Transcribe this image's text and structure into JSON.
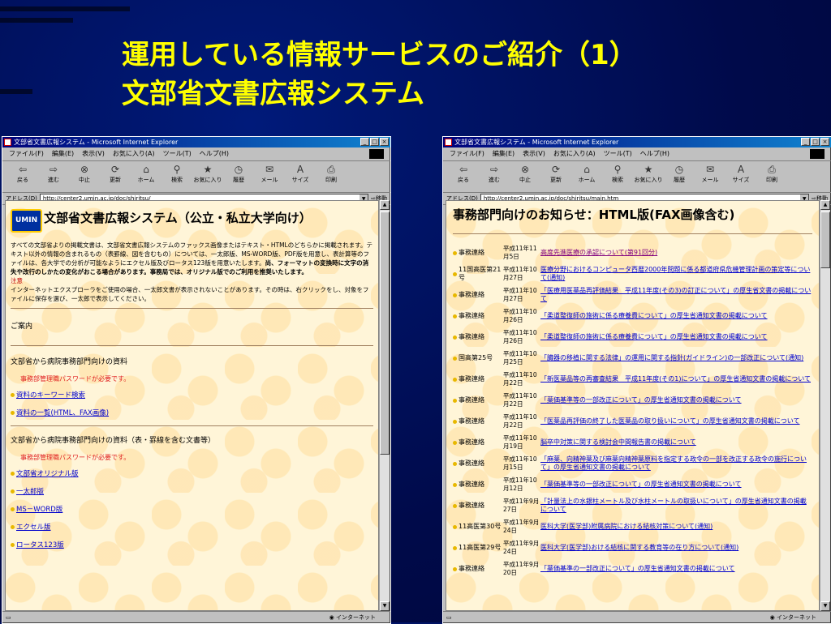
{
  "slide": {
    "title_line1": "運用している情報サービスのご紹介（1）",
    "title_line2": "文部省文書広報システム"
  },
  "left_window": {
    "title": "文部省文書広報システム - Microsoft Internet Explorer",
    "menu": [
      "ファイル(F)",
      "編集(E)",
      "表示(V)",
      "お気に入り(A)",
      "ツール(T)",
      "ヘルプ(H)"
    ],
    "toolbar": [
      {
        "label": "戻る",
        "icon": "back-arrow-icon",
        "glyph": "⇦"
      },
      {
        "label": "進む",
        "icon": "forward-arrow-icon",
        "glyph": "⇨"
      },
      {
        "label": "中止",
        "icon": "stop-icon",
        "glyph": "⊗"
      },
      {
        "label": "更新",
        "icon": "refresh-icon",
        "glyph": "⟳"
      },
      {
        "label": "ホーム",
        "icon": "home-icon",
        "glyph": "⌂"
      },
      {
        "label": "検索",
        "icon": "search-icon",
        "glyph": "⚲"
      },
      {
        "label": "お気に入り",
        "icon": "favorites-icon",
        "glyph": "★"
      },
      {
        "label": "履歴",
        "icon": "history-icon",
        "glyph": "◷"
      },
      {
        "label": "メール",
        "icon": "mail-icon",
        "glyph": "✉"
      },
      {
        "label": "サイズ",
        "icon": "font-size-icon",
        "glyph": "A"
      },
      {
        "label": "印刷",
        "icon": "print-icon",
        "glyph": "⎙"
      }
    ],
    "address_label": "アドレス(D)",
    "address": "http://center2.umin.ac.jp/doc/shiritsu/",
    "go_label": "移動",
    "status_zone": "インターネット",
    "page": {
      "logo": "UMIN",
      "heading": "文部省文書広報システム（公立・私立大学向け）",
      "desc_normal": "すべての文部省よりの掲載文書は、文部省文書広報システムのファックス画像またはテキスト・HTMLのどちらかに掲載されます。テキスト以外の情報の含まれるもの（表罫線、図を含むもの）については、一太郎版、MS-WORD版、PDF版を用意し、表計算等のファイルは、各大学での分析が可能なようにエクセル版及びロータス123版を用意いたします。",
      "desc_bold": "尚、フォーマットの変換時に文字の消失や改行のしかたの変化がおこる場合があります。事務局では、オリジナル版でのご利用を推奨いたします。",
      "note_label": "注意",
      "note_text": "インターネットエクスプローラをご使用の場合、一太郎文書が表示されないことがあります。その時は、右クリックをし、対象をファイルに保存を選び、一太郎で表示してください。",
      "guide": "ご案内",
      "section1": "文部省から病院事務部門向けの資料",
      "password_note1": "事務部管理職パスワードが必要です。",
      "links1": [
        "資料のキーワード検索",
        "資料の一覧(HTML、FAX画像)"
      ],
      "section2": "文部省から病院事務部門向けの資料（表・罫線を含む文書等）",
      "password_note2": "事務部管理職パスワードが必要です。",
      "links2": [
        "文部省オリジナル版",
        "一太郎版",
        "MS－WORD版",
        "エクセル版",
        "ロータス123版"
      ]
    }
  },
  "right_window": {
    "title": "文部省文書広報システム - Microsoft Internet Explorer",
    "address": "http://center2.umin.ac.jp/doc/shiritsu/main.htm",
    "page": {
      "heading": "事務部門向けのお知らせ：HTML版(FAX画像含む)",
      "rows": [
        {
          "cat": "事務連絡",
          "date": "平成11年11月5日",
          "title": "高度先進医療の承認について(第91回分)",
          "visited": true
        },
        {
          "cat": "11国高医第21号",
          "date": "平成11年10月27日",
          "title": "医療分野におけるコンピュータ西暦2000年問題に係る都道府県危機管理計画の策定等について(通知)",
          "visited": false
        },
        {
          "cat": "事務連絡",
          "date": "平成11年10月27日",
          "title": "「医療用医薬品再評価結果　平成11年度(その3)の訂正について」の厚生省文書の掲載について",
          "visited": false
        },
        {
          "cat": "事務連絡",
          "date": "平成11年10月26日",
          "title": "「柔道整復師の施術に係る療養費について」の厚生省通知文書の掲載について",
          "visited": false
        },
        {
          "cat": "事務連絡",
          "date": "平成11年10月26日",
          "title": "「柔道整復師の施術に係る療養費について」の厚生省通知文書の掲載について",
          "visited": false
        },
        {
          "cat": "国高第25号",
          "date": "平成11年10月25日",
          "title": "「臓器の移植に関する法律」の運用に関する指針(ガイドライン)の一部改正について(通知)",
          "visited": false
        },
        {
          "cat": "事務連絡",
          "date": "平成11年10月22日",
          "title": "「新医薬品等の再審査結果　平成11年度(その1)について」の厚生省通知文書の掲載について",
          "visited": false
        },
        {
          "cat": "事務連絡",
          "date": "平成11年10月22日",
          "title": "「薬価基準等の一部改正について」の厚生省通知文書の掲載について",
          "visited": false
        },
        {
          "cat": "事務連絡",
          "date": "平成11年10月22日",
          "title": "「医薬品再評価の終了した医薬品の取り扱いについて」の厚生省通知文書の掲載について",
          "visited": false
        },
        {
          "cat": "事務連絡",
          "date": "平成11年10月19日",
          "title": "脳卒中対策に関する検討会中間報告書の掲載について",
          "visited": false
        },
        {
          "cat": "事務連絡",
          "date": "平成11年10月15日",
          "title": "「麻薬、向精神薬及び麻薬向精神薬原料を指定する政令の一部を改正する政令の施行について」の厚生省通知文書の掲載について",
          "visited": false
        },
        {
          "cat": "事務連絡",
          "date": "平成11年10月12日",
          "title": "「薬価基準等の一部改正について」の厚生省通知文書の掲載について",
          "visited": false
        },
        {
          "cat": "事務連絡",
          "date": "平成11年9月27日",
          "title": "「計量法上の水銀柱メートル及び水柱メートルの取扱いについて」の厚生省通知文書の掲載について",
          "visited": false
        },
        {
          "cat": "11高医第30号",
          "date": "平成11年9月24日",
          "title": "医科大学(医学部)附属病院における結核対策について(通知)",
          "visited": false
        },
        {
          "cat": "11高医第29号",
          "date": "平成11年9月24日",
          "title": "医科大学(医学部)おける結核に関する教育等の在り方について(通知)",
          "visited": false
        },
        {
          "cat": "事務連絡",
          "date": "平成11年9月20日",
          "title": "「薬価基準の一部改正について」の厚生省通知文書の掲載について",
          "visited": false
        }
      ]
    }
  }
}
